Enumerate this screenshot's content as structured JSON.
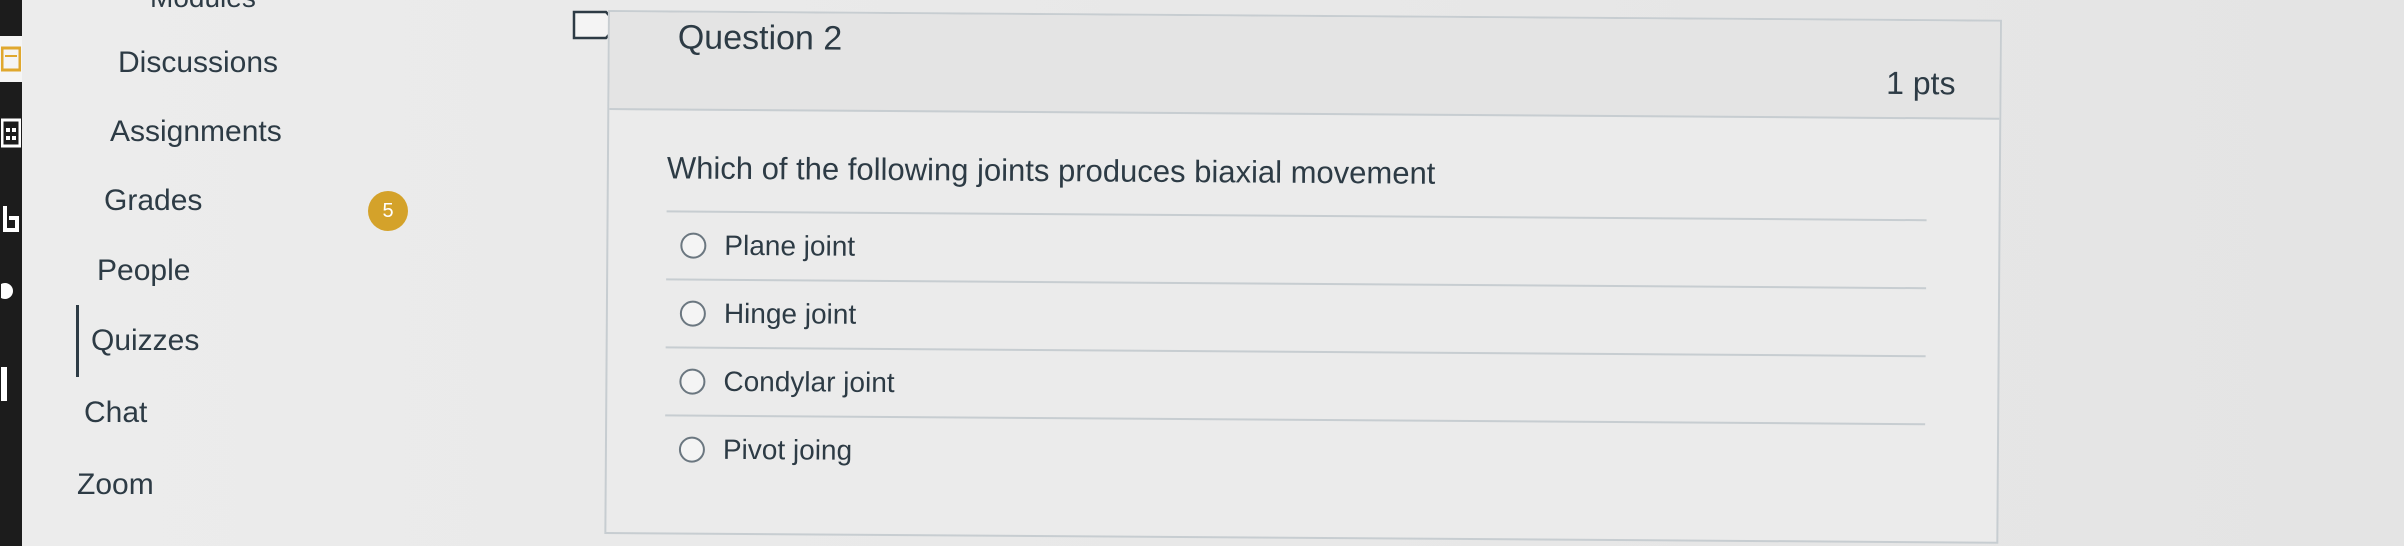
{
  "sidebar": {
    "partial_top_label": "Modules",
    "items": [
      {
        "label": "Discussions"
      },
      {
        "label": "Assignments"
      },
      {
        "label": "Grades",
        "badge": "5"
      },
      {
        "label": "People"
      },
      {
        "label": "Quizzes",
        "active": true
      },
      {
        "label": "Chat"
      },
      {
        "label": "Zoom"
      }
    ]
  },
  "question": {
    "title": "Question 2",
    "points": "1 pts",
    "text": "Which of the following joints produces biaxial movement",
    "answers": [
      {
        "label": "Plane joint"
      },
      {
        "label": "Hinge joint"
      },
      {
        "label": "Condylar joint"
      },
      {
        "label": "Pivot joing"
      }
    ]
  },
  "colors": {
    "badge": "#d4a22a",
    "text": "#2d3b45",
    "border": "#c7cdd1",
    "global_nav": "#1c1c1c"
  },
  "icons": {
    "bookmark": "bookmark-flag-icon",
    "global_nav": [
      "inbox-icon",
      "calendar-icon",
      "history-icon",
      "help-icon"
    ]
  }
}
